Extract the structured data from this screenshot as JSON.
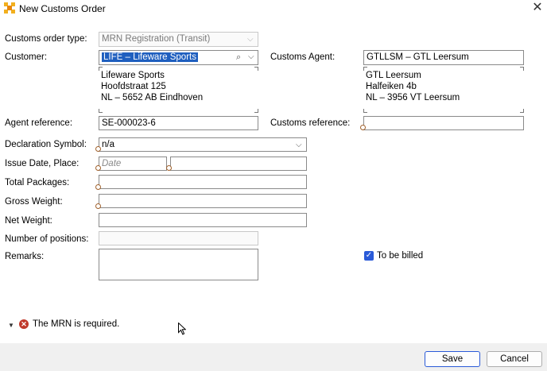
{
  "window": {
    "title": "New Customs Order",
    "close_label": "✕"
  },
  "form": {
    "customs_order_type": {
      "label": "Customs order type:",
      "value": "MRN Registration (Transit)"
    },
    "customer": {
      "label": "Customer:",
      "value": "LIFE – Lifeware Sports",
      "address": [
        "Lifeware Sports",
        "Hoofdstraat 125",
        "NL – 5652 AB Eindhoven"
      ]
    },
    "customs_agent": {
      "label": "Customs Agent:",
      "value": "GTLLSM – GTL Leersum",
      "address": [
        "GTL Leersum",
        "Halfeiken 4b",
        "NL – 3956 VT Leersum"
      ]
    },
    "agent_reference": {
      "label": "Agent reference:",
      "value": "SE-000023-6"
    },
    "customs_reference": {
      "label": "Customs reference:",
      "value": ""
    },
    "declaration_symbol": {
      "label": "Declaration Symbol:",
      "value": "n/a"
    },
    "issue_date_place": {
      "label": "Issue Date, Place:",
      "date_placeholder": "Date",
      "place_value": ""
    },
    "total_packages": {
      "label": "Total Packages:",
      "value": ""
    },
    "gross_weight": {
      "label": "Gross Weight:",
      "value": ""
    },
    "net_weight": {
      "label": "Net Weight:",
      "value": ""
    },
    "number_of_positions": {
      "label": "Number of positions:",
      "value": ""
    },
    "remarks": {
      "label": "Remarks:",
      "value": ""
    },
    "to_be_billed": {
      "label": "To be billed",
      "checked": true
    }
  },
  "validation": {
    "message": "The MRN is required."
  },
  "footer": {
    "save_label": "Save",
    "cancel_label": "Cancel"
  },
  "colors": {
    "accent": "#2a5ad8",
    "selection": "#1f5fbf",
    "error": "#c0392b",
    "footer_bg": "#f0f0f0"
  }
}
